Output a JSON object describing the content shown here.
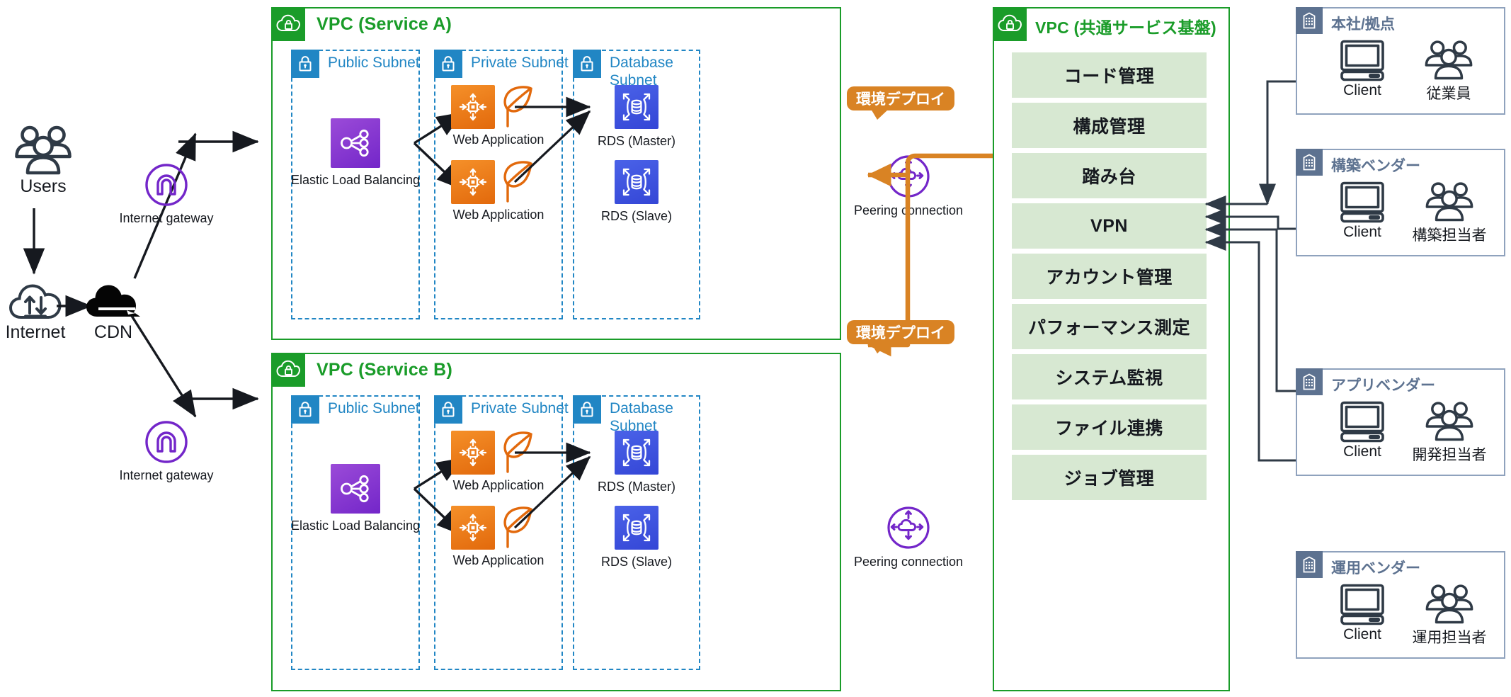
{
  "left": {
    "users": {
      "label": "Users",
      "icon": "users-icon"
    },
    "internet": {
      "label": "Internet",
      "icon": "internet-cloud-icon"
    },
    "cdn": {
      "label": "CDN",
      "icon": "cdn-cloud-icon"
    }
  },
  "vpcs": [
    {
      "title": "VPC (Service A)",
      "icon": "vpc-cloud-lock-icon",
      "subnets": [
        {
          "title": "Public Subnet",
          "icon": "subnet-lock-icon"
        },
        {
          "title": "Private Subnet",
          "icon": "subnet-lock-icon"
        },
        {
          "title": "Database\nSubnet",
          "icon": "subnet-lock-icon"
        }
      ],
      "gateway": {
        "label": "Internet gateway",
        "icon": "internet-gateway-icon"
      },
      "elb": {
        "label": "Elastic Load Balancing",
        "icon": "elastic-load-balancing-icon"
      },
      "apps": [
        {
          "label": "Web Application",
          "icon": "ec2-instance-icon",
          "leaf": "elastic-beanstalk-leaf-icon"
        },
        {
          "label": "Web Application",
          "icon": "ec2-instance-icon",
          "leaf": "elastic-beanstalk-leaf-icon"
        }
      ],
      "databases": [
        {
          "label": "RDS (Master)",
          "icon": "rds-database-icon"
        },
        {
          "label": "RDS (Slave)",
          "icon": "rds-database-icon"
        }
      ],
      "peering": {
        "label": "Peering connection",
        "icon": "peering-connection-icon"
      },
      "deploy_badge": "環境デプロイ"
    },
    {
      "title": "VPC (Service B)",
      "icon": "vpc-cloud-lock-icon",
      "subnets": [
        {
          "title": "Public Subnet",
          "icon": "subnet-lock-icon"
        },
        {
          "title": "Private Subnet",
          "icon": "subnet-lock-icon"
        },
        {
          "title": "Database\nSubnet",
          "icon": "subnet-lock-icon"
        }
      ],
      "gateway": {
        "label": "Internet gateway",
        "icon": "internet-gateway-icon"
      },
      "elb": {
        "label": "Elastic Load Balancing",
        "icon": "elastic-load-balancing-icon"
      },
      "apps": [
        {
          "label": "Web Application",
          "icon": "ec2-instance-icon",
          "leaf": "elastic-beanstalk-leaf-icon"
        },
        {
          "label": "Web Application",
          "icon": "ec2-instance-icon",
          "leaf": "elastic-beanstalk-leaf-icon"
        }
      ],
      "databases": [
        {
          "label": "RDS (Master)",
          "icon": "rds-database-icon"
        },
        {
          "label": "RDS (Slave)",
          "icon": "rds-database-icon"
        }
      ],
      "peering": {
        "label": "Peering connection",
        "icon": "peering-connection-icon"
      },
      "deploy_badge": "環境デプロイ"
    }
  ],
  "common_vpc": {
    "title": "VPC (共通サービス基盤)",
    "icon": "vpc-cloud-lock-icon",
    "services": [
      {
        "label": "コード管理"
      },
      {
        "label": "構成管理"
      },
      {
        "label": "踏み台"
      },
      {
        "label": "VPN"
      },
      {
        "label": "アカウント管理"
      },
      {
        "label": "パフォーマンス測定"
      },
      {
        "label": "システム監視"
      },
      {
        "label": "ファイル連携"
      },
      {
        "label": "ジョブ管理"
      }
    ]
  },
  "vendors": [
    {
      "title": "本社/拠点",
      "icon": "building-icon",
      "client_label": "Client",
      "people_label": "従業員",
      "client_icon": "desktop-computer-icon",
      "people_icon": "users-icon"
    },
    {
      "title": "構築ベンダー",
      "icon": "building-icon",
      "client_label": "Client",
      "people_label": "構築担当者",
      "client_icon": "desktop-computer-icon",
      "people_icon": "users-icon"
    },
    {
      "title": "アプリベンダー",
      "icon": "building-icon",
      "client_label": "Client",
      "people_label": "開発担当者",
      "client_icon": "desktop-computer-icon",
      "people_icon": "users-icon"
    },
    {
      "title": "運用ベンダー",
      "icon": "building-icon",
      "client_label": "Client",
      "people_label": "運用担当者",
      "client_icon": "desktop-computer-icon",
      "people_icon": "users-icon"
    }
  ],
  "colors": {
    "vpc_green": "#1a9c29",
    "subnet_blue": "#2186c4",
    "elb_purple": "#7326c9",
    "ec2_orange": "#e2690c",
    "rds_blue": "#3446d6",
    "service_green": "#d7e8d2",
    "vendor_slate": "#5d7290",
    "deploy_orange": "#d98324",
    "line_dark": "#2f3a46"
  }
}
